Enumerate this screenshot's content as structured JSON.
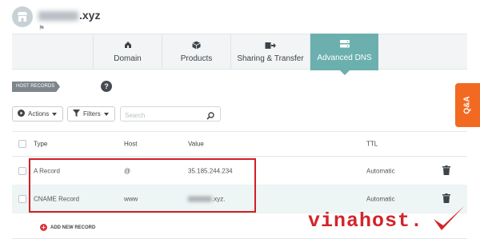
{
  "site": {
    "title_suffix": ".xyz"
  },
  "tabs": [
    {
      "label": "Domain",
      "icon": "house-icon"
    },
    {
      "label": "Products",
      "icon": "box-icon"
    },
    {
      "label": "Sharing & Transfer",
      "icon": "share-arrow-icon"
    },
    {
      "label": "Advanced DNS",
      "icon": "server-icon",
      "active": true
    }
  ],
  "section": {
    "badge": "HOST RECORDS",
    "help": "?"
  },
  "qa_tab": "Q&A",
  "toolbar": {
    "actions_label": "Actions",
    "filters_label": "Filters",
    "search_placeholder": "Search"
  },
  "table": {
    "columns": {
      "type": "Type",
      "host": "Host",
      "value": "Value",
      "ttl": "TTL"
    },
    "rows": [
      {
        "type": "A Record",
        "host": "@",
        "value": "35.185.244.234",
        "ttl": "Automatic"
      },
      {
        "type": "CNAME Record",
        "host": "www",
        "value_suffix": ".xyz.",
        "ttl": "Automatic"
      }
    ]
  },
  "add_record_label": "ADD NEW RECORD",
  "watermark": "vinahost.",
  "colors": {
    "accent": "#6bb0ae",
    "highlight_border": "#d11f26",
    "qa_orange": "#f26a21",
    "watermark_red": "#d3242a"
  }
}
